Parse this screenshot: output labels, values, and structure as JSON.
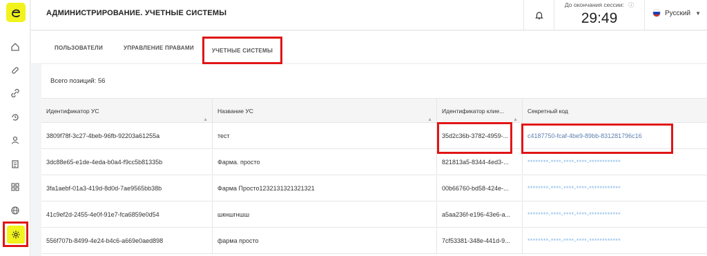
{
  "header": {
    "title": "АДМИНИСТРИРОВАНИЕ. УЧЕТНЫЕ СИСТЕМЫ",
    "session_label": "До окончания сессии:",
    "session_time": "29:49",
    "language": "Русский"
  },
  "tabs": [
    {
      "label": "ПОЛЬЗОВАТЕЛИ"
    },
    {
      "label": "УПРАВЛЕНИЕ ПРАВАМИ"
    },
    {
      "label": "УЧЕТНЫЕ СИСТЕМЫ"
    }
  ],
  "summary": {
    "total_label": "Всего позиций: 56"
  },
  "table": {
    "columns": [
      "Идентификатор УС",
      "Название УС",
      "Идентификатор клие...",
      "Секретный код"
    ],
    "rows": [
      {
        "id": "3809f78f-3c27-4beb-96fb-92203a61255a",
        "name": "тест",
        "client_id": "35d2c36b-3782-4959-...",
        "secret": "c4187750-fcaf-4be9-89bb-831281796c16"
      },
      {
        "id": "3dc88e65-e1de-4eda-b0a4-f9cc5b81335b",
        "name": "Фарма. просто",
        "client_id": "821813a5-8344-4ed3-...",
        "secret": "********-****-****-****-************"
      },
      {
        "id": "3fa1aebf-01a3-419d-8d0d-7ae9565bb38b",
        "name": "Фарма Просто1232131321321321",
        "client_id": "00b66760-bd58-424e-...",
        "secret": "********-****-****-****-************"
      },
      {
        "id": "41c9ef2d-2455-4e0f-91e7-fca6859e0d54",
        "name": "шкншгншш",
        "client_id": "a5aa236f-e196-43e6-a...",
        "secret": "********-****-****-****-************"
      },
      {
        "id": "556f707b-8499-4e24-b4c6-a669e0aed898",
        "name": "фарма просто",
        "client_id": "7cf53381-348e-441d-9...",
        "secret": "********-****-****-****-************"
      }
    ]
  },
  "colors": {
    "accent_yellow": "#f2f21c",
    "highlight_red": "#e11515",
    "secret_link": "#5a7fb0"
  }
}
